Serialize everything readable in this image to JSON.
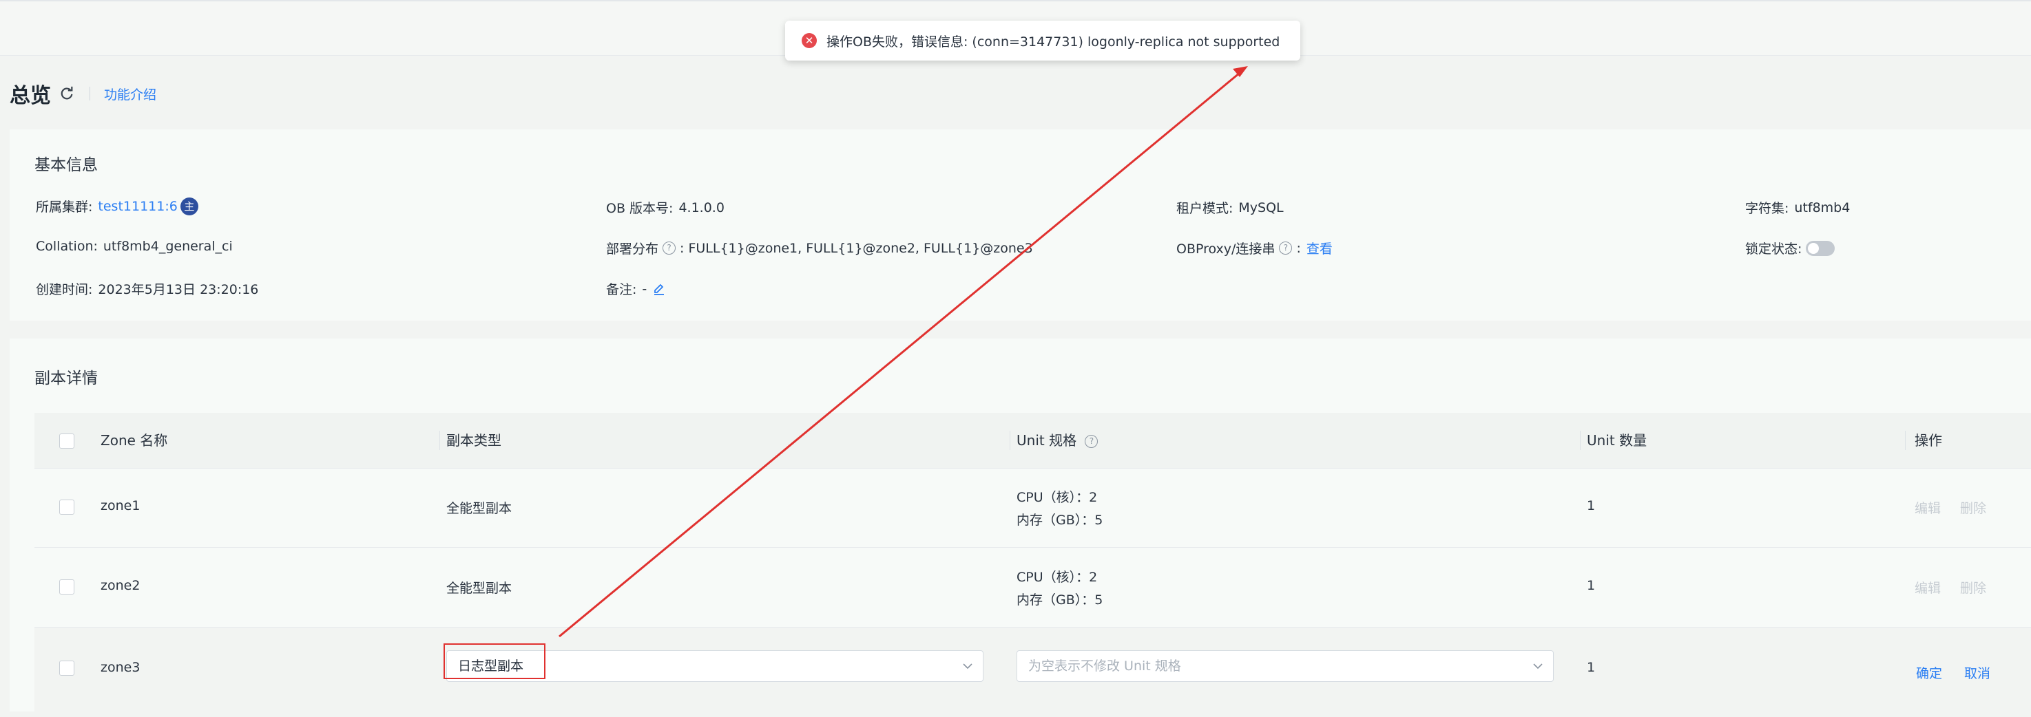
{
  "toast": {
    "message": "操作OB失败，错误信息: (conn=3147731) logonly-replica not supported",
    "icon": "error-circle-icon",
    "color": "#e5484d"
  },
  "page": {
    "title": "总览",
    "help_link": "功能介绍"
  },
  "basic_info": {
    "title": "基本信息",
    "cluster_label": "所属集群:",
    "cluster_value": "test11111:6",
    "cluster_badge": "主",
    "version_label": "OB 版本号:",
    "version_value": "4.1.0.0",
    "tenant_mode_label": "租户模式:",
    "tenant_mode_value": "MySQL",
    "charset_label": "字符集:",
    "charset_value": "utf8mb4",
    "collation_label": "Collation:",
    "collation_value": "utf8mb4_general_ci",
    "deploy_label": "部署分布",
    "deploy_value": ": FULL{1}@zone1, FULL{1}@zone2, FULL{1}@zone3",
    "obproxy_label": "OBProxy/连接串",
    "obproxy_value": "查看",
    "lock_label": "锁定状态:",
    "created_label": "创建时间:",
    "created_value": "2023年5月13日 23:20:16",
    "remark_label": "备注:",
    "remark_value": "-"
  },
  "replica": {
    "title": "副本详情",
    "columns": [
      "Zone 名称",
      "副本类型",
      "Unit 规格",
      "Unit 数量",
      "操作"
    ],
    "rows": [
      {
        "zone": "zone1",
        "type": "全能型副本",
        "cpu": "CPU（核）：2",
        "mem": "内存（GB）：5",
        "count": "1",
        "edit": "编辑",
        "delete": "删除"
      },
      {
        "zone": "zone2",
        "type": "全能型副本",
        "cpu": "CPU（核）：2",
        "mem": "内存（GB）：5",
        "count": "1",
        "edit": "编辑",
        "delete": "删除"
      }
    ],
    "edit_row": {
      "zone": "zone3",
      "type_select": "日志型副本",
      "unit_placeholder": "为空表示不修改 Unit 规格",
      "count": "1",
      "confirm": "确定",
      "cancel": "取消"
    }
  },
  "colors": {
    "accent": "#2b7ef3",
    "annotation": "#e0312f",
    "disabled_text": "#c6ccd2"
  }
}
